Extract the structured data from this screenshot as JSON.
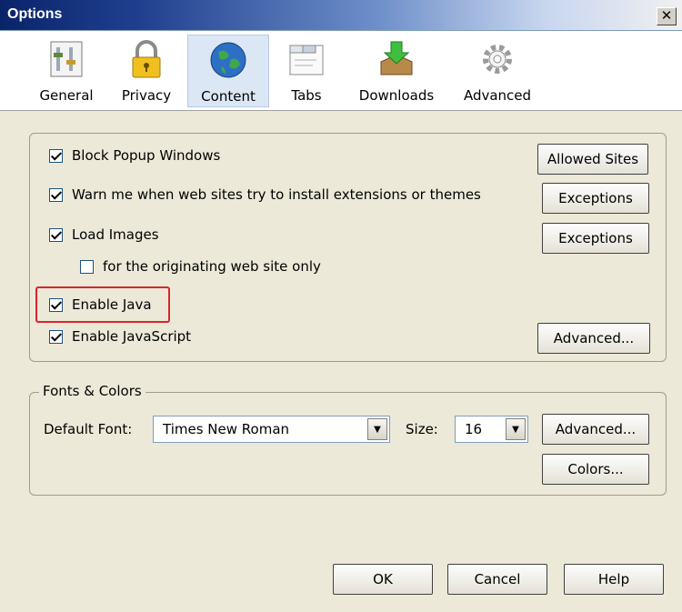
{
  "window": {
    "title": "Options",
    "close": "✕"
  },
  "toolbar": {
    "items": [
      {
        "label": "General",
        "icon": "general-icon"
      },
      {
        "label": "Privacy",
        "icon": "lock-icon"
      },
      {
        "label": "Content",
        "icon": "globe-icon",
        "selected": true
      },
      {
        "label": "Tabs",
        "icon": "tabs-icon"
      },
      {
        "label": "Downloads",
        "icon": "downloads-icon"
      },
      {
        "label": "Advanced",
        "icon": "gear-icon"
      }
    ]
  },
  "content": {
    "block_popups": {
      "label": "Block Popup Windows",
      "checked": true
    },
    "warn_extensions": {
      "label": "Warn me when web sites try to install extensions or themes",
      "checked": true
    },
    "load_images": {
      "label": "Load Images",
      "checked": true
    },
    "originating_only": {
      "label": "for the originating web site only",
      "checked": false
    },
    "enable_java": {
      "label": "Enable Java",
      "checked": true
    },
    "enable_javascript": {
      "label": "Enable JavaScript",
      "checked": true
    },
    "buttons": {
      "allowed_sites": "Allowed Sites",
      "exceptions_1": "Exceptions",
      "exceptions_2": "Exceptions",
      "advanced": "Advanced..."
    }
  },
  "fonts": {
    "legend": "Fonts & Colors",
    "default_font_label": "Default Font:",
    "default_font_value": "Times New Roman",
    "size_label": "Size:",
    "size_value": "16",
    "advanced_button": "Advanced...",
    "colors_button": "Colors..."
  },
  "footer": {
    "ok": "OK",
    "cancel": "Cancel",
    "help": "Help"
  },
  "colors": {
    "highlight": "#d9252b",
    "selected_tab": "#dce7f5"
  }
}
